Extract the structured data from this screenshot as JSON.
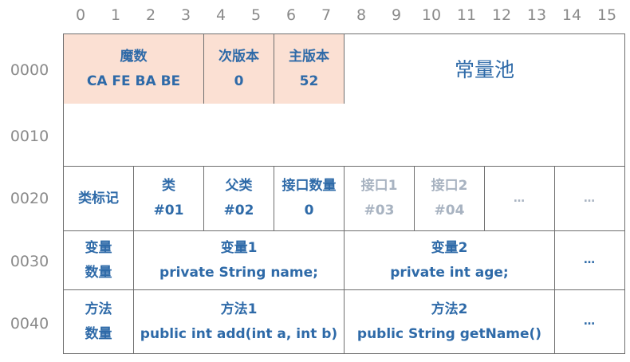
{
  "column_headers": [
    "0",
    "1",
    "2",
    "3",
    "4",
    "5",
    "6",
    "7",
    "8",
    "9",
    "10",
    "11",
    "12",
    "13",
    "14",
    "15"
  ],
  "row_headers": [
    "0000",
    "0010",
    "0020",
    "0030",
    "0040"
  ],
  "cells": {
    "magic": {
      "title": "魔数",
      "value": "CA FE BA BE"
    },
    "minor": {
      "title": "次版本",
      "value": "0"
    },
    "major": {
      "title": "主版本",
      "value": "52"
    },
    "pool": {
      "title": "常量池"
    },
    "access": {
      "title": "类标记"
    },
    "this_class": {
      "title": "类",
      "value": "#01"
    },
    "super_class": {
      "title": "父类",
      "value": "#02"
    },
    "iface_count": {
      "title": "接口数量",
      "value": "0"
    },
    "iface1": {
      "title": "接口1",
      "value": "#03"
    },
    "iface2": {
      "title": "接口2",
      "value": "#04"
    },
    "ellipsis": "…",
    "field_count": {
      "line1": "变量",
      "line2": "数量"
    },
    "field1": {
      "title": "变量1",
      "value": "private String name;"
    },
    "field2": {
      "title": "变量2",
      "value": "private int age;"
    },
    "method_count": {
      "line1": "方法",
      "line2": "数量"
    },
    "method1": {
      "title": "方法1",
      "value": "public int add(int a, int b)"
    },
    "method2": {
      "title": "方法2",
      "value": "public String getName()"
    }
  },
  "colors": {
    "header_fill": "#fbe0d3",
    "text_blue": "#2e6aa8",
    "muted": "#a8b3c1",
    "border": "#6f6f6f"
  }
}
